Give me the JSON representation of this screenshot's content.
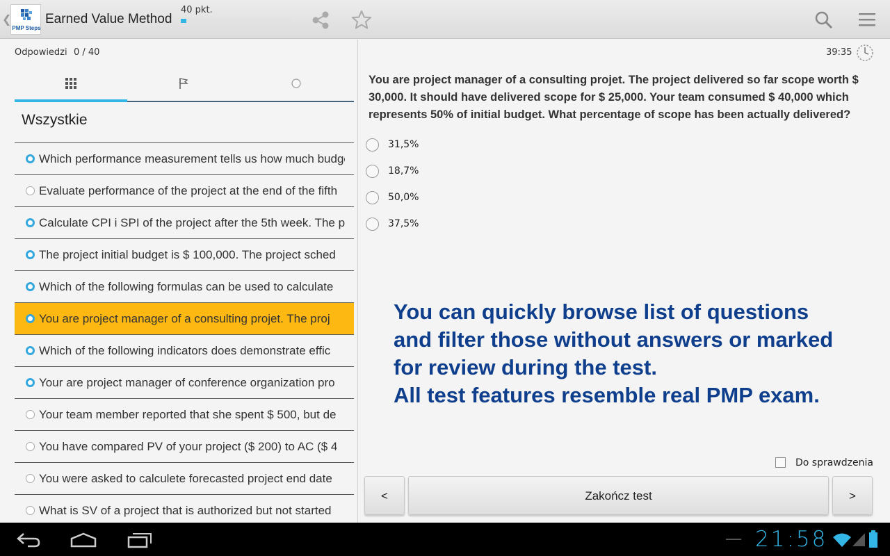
{
  "app": {
    "title": "Earned Value Method",
    "logo_text": "PMP Steps",
    "score_label": "40 pkt.",
    "score_progress": 0.05
  },
  "left_panel": {
    "answers_label": "Odpowiedzi",
    "answers_count": "0 / 40",
    "tabs": [
      {
        "icon": "grid-icon",
        "active": true
      },
      {
        "icon": "flag-icon",
        "active": false
      },
      {
        "icon": "unanswered-circle-icon",
        "active": false
      }
    ],
    "section_title": "Wszystkie",
    "questions": [
      {
        "text": "Which performance measurement tells us how much budget",
        "answered": true,
        "selected": false
      },
      {
        "text": "Evaluate performance of the project at the end of the fifth",
        "answered": false,
        "selected": false
      },
      {
        "text": "Calculate CPI i SPI of the project after the 5th week. The p",
        "answered": true,
        "selected": false
      },
      {
        "text": "The project initial budget is $ 100,000. The project sched",
        "answered": true,
        "selected": false
      },
      {
        "text": "Which of the following formulas can be used to calculate",
        "answered": true,
        "selected": false
      },
      {
        "text": "You are project manager of a consulting projet. The proj",
        "answered": true,
        "selected": true
      },
      {
        "text": "Which of the following indicators does demonstrate effic",
        "answered": true,
        "selected": false
      },
      {
        "text": "Your are project manager of conference organization pro",
        "answered": true,
        "selected": false
      },
      {
        "text": "Your team member reported that she spent $ 500, but de",
        "answered": false,
        "selected": false
      },
      {
        "text": "You have compared PV of your project ($ 200) to AC ($ 4",
        "answered": false,
        "selected": false
      },
      {
        "text": "You were asked to calculete forecasted project end date",
        "answered": false,
        "selected": false
      },
      {
        "text": "What is SV of a project that is authorized but not started",
        "answered": false,
        "selected": false
      }
    ]
  },
  "right_panel": {
    "timer": "39:35",
    "question": "You are project manager of a consulting projet. The project delivered so far scope worth $ 30,000. It should have delivered scope for $ 25,000. Your team consumed $ 40,000 which represents 50% of initial budget. What percentage of scope has been actually delivered?",
    "options": [
      "31,5%",
      "18,7%",
      "50,0%",
      "37,5%"
    ],
    "promo_lines": [
      "You can quickly browse list of questions",
      "and filter those without answers or marked",
      "for review during the test.",
      "All test features resemble real PMP exam."
    ],
    "review_label": "Do sprawdzenia",
    "prev_label": "<",
    "finish_label": "Zakończ test",
    "next_label": ">"
  },
  "system_bar": {
    "clock": "21:58"
  },
  "colors": {
    "accent": "#33b5e5",
    "selected_row": "#fdb911",
    "promo_text": "#0f3f8c"
  }
}
